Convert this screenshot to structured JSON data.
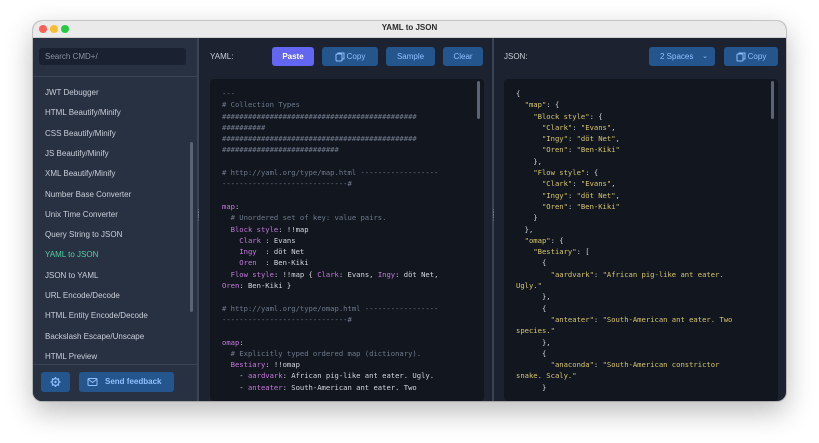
{
  "window": {
    "title": "YAML to JSON"
  },
  "sidebar": {
    "search_placeholder": "Search CMD+/",
    "items": [
      {
        "label": "JWT Debugger",
        "active": false
      },
      {
        "label": "HTML Beautify/Minify",
        "active": false
      },
      {
        "label": "CSS Beautify/Minify",
        "active": false
      },
      {
        "label": "JS Beautify/Minify",
        "active": false
      },
      {
        "label": "XML Beautify/Minify",
        "active": false
      },
      {
        "label": "Number Base Converter",
        "active": false
      },
      {
        "label": "Unix Time Converter",
        "active": false
      },
      {
        "label": "Query String to JSON",
        "active": false
      },
      {
        "label": "YAML to JSON",
        "active": true
      },
      {
        "label": "JSON to YAML",
        "active": false
      },
      {
        "label": "URL Encode/Decode",
        "active": false
      },
      {
        "label": "HTML Entity Encode/Decode",
        "active": false
      },
      {
        "label": "Backslash Escape/Unscape",
        "active": false
      },
      {
        "label": "HTML Preview",
        "active": false
      }
    ],
    "settings_icon": "gear-icon",
    "feedback_label": "Send feedback",
    "feedback_icon": "mail-icon"
  },
  "yaml_panel": {
    "label": "YAML:",
    "paste_label": "Paste",
    "copy_label": "Copy",
    "sample_label": "Sample",
    "clear_label": "Clear",
    "lines": [
      [
        {
          "t": "---",
          "c": "cm"
        }
      ],
      [
        {
          "t": "# Collection Types",
          "c": "cm"
        }
      ],
      [
        {
          "t": "#############################################",
          "c": "cm"
        }
      ],
      [
        {
          "t": "##########",
          "c": "cm"
        }
      ],
      [
        {
          "t": "#############################################",
          "c": "cm"
        }
      ],
      [
        {
          "t": "###########################",
          "c": "cm"
        }
      ],
      [],
      [
        {
          "t": "# http://yaml.org/type/map.html ------------------",
          "c": "cm"
        }
      ],
      [
        {
          "t": "-----------------------------#",
          "c": "cm"
        }
      ],
      [],
      [
        {
          "t": "map",
          "c": "ky"
        },
        {
          "t": ":",
          "c": "vl"
        }
      ],
      [
        {
          "t": "  # Unordered set of key: value pairs.",
          "c": "cm"
        }
      ],
      [
        {
          "t": "  Block style",
          "c": "ky"
        },
        {
          "t": ": !!map",
          "c": "vl"
        }
      ],
      [
        {
          "t": "    Clark ",
          "c": "ky"
        },
        {
          "t": ": Evans",
          "c": "vl"
        }
      ],
      [
        {
          "t": "    Ingy  ",
          "c": "ky"
        },
        {
          "t": ": döt Net",
          "c": "vl"
        }
      ],
      [
        {
          "t": "    Oren  ",
          "c": "ky"
        },
        {
          "t": ": Ben-Kiki",
          "c": "vl"
        }
      ],
      [
        {
          "t": "  Flow style",
          "c": "ky"
        },
        {
          "t": ": !!map { ",
          "c": "vl"
        },
        {
          "t": "Clark",
          "c": "ky"
        },
        {
          "t": ": Evans, ",
          "c": "vl"
        },
        {
          "t": "Ingy",
          "c": "ky"
        },
        {
          "t": ": döt Net,",
          "c": "vl"
        }
      ],
      [
        {
          "t": "Oren",
          "c": "ky"
        },
        {
          "t": ": Ben-Kiki }",
          "c": "vl"
        }
      ],
      [],
      [
        {
          "t": "# http://yaml.org/type/omap.html -----------------",
          "c": "cm"
        }
      ],
      [
        {
          "t": "-----------------------------#",
          "c": "cm"
        }
      ],
      [],
      [
        {
          "t": "omap",
          "c": "ky"
        },
        {
          "t": ":",
          "c": "vl"
        }
      ],
      [
        {
          "t": "  # Explicitly typed ordered map (dictionary).",
          "c": "cm"
        }
      ],
      [
        {
          "t": "  Bestiary",
          "c": "ky"
        },
        {
          "t": ": !!omap",
          "c": "vl"
        }
      ],
      [
        {
          "t": "    - ",
          "c": "vl"
        },
        {
          "t": "aardvark",
          "c": "ky"
        },
        {
          "t": ": African pig-like ant eater. Ugly.",
          "c": "vl"
        }
      ],
      [
        {
          "t": "    - ",
          "c": "vl"
        },
        {
          "t": "anteater",
          "c": "ky"
        },
        {
          "t": ": South-American ant eater. Two",
          "c": "vl"
        }
      ]
    ]
  },
  "json_panel": {
    "label": "JSON:",
    "indent_select": "2 Spaces",
    "copy_label": "Copy",
    "lines": [
      [
        {
          "t": "{",
          "c": "vl"
        }
      ],
      [
        {
          "t": "  ",
          "c": "vl"
        },
        {
          "t": "\"map\"",
          "c": "js-k"
        },
        {
          "t": ": {",
          "c": "vl"
        }
      ],
      [
        {
          "t": "    ",
          "c": "vl"
        },
        {
          "t": "\"Block style\"",
          "c": "js-k"
        },
        {
          "t": ": {",
          "c": "vl"
        }
      ],
      [
        {
          "t": "      ",
          "c": "vl"
        },
        {
          "t": "\"Clark\"",
          "c": "js-k"
        },
        {
          "t": ": ",
          "c": "vl"
        },
        {
          "t": "\"Evans\"",
          "c": "js-s"
        },
        {
          "t": ",",
          "c": "vl"
        }
      ],
      [
        {
          "t": "      ",
          "c": "vl"
        },
        {
          "t": "\"Ingy\"",
          "c": "js-k"
        },
        {
          "t": ": ",
          "c": "vl"
        },
        {
          "t": "\"döt Net\"",
          "c": "js-s"
        },
        {
          "t": ",",
          "c": "vl"
        }
      ],
      [
        {
          "t": "      ",
          "c": "vl"
        },
        {
          "t": "\"Oren\"",
          "c": "js-k"
        },
        {
          "t": ": ",
          "c": "vl"
        },
        {
          "t": "\"Ben-Kiki\"",
          "c": "js-s"
        }
      ],
      [
        {
          "t": "    },",
          "c": "vl"
        }
      ],
      [
        {
          "t": "    ",
          "c": "vl"
        },
        {
          "t": "\"Flow style\"",
          "c": "js-k"
        },
        {
          "t": ": {",
          "c": "vl"
        }
      ],
      [
        {
          "t": "      ",
          "c": "vl"
        },
        {
          "t": "\"Clark\"",
          "c": "js-k"
        },
        {
          "t": ": ",
          "c": "vl"
        },
        {
          "t": "\"Evans\"",
          "c": "js-s"
        },
        {
          "t": ",",
          "c": "vl"
        }
      ],
      [
        {
          "t": "      ",
          "c": "vl"
        },
        {
          "t": "\"Ingy\"",
          "c": "js-k"
        },
        {
          "t": ": ",
          "c": "vl"
        },
        {
          "t": "\"döt Net\"",
          "c": "js-s"
        },
        {
          "t": ",",
          "c": "vl"
        }
      ],
      [
        {
          "t": "      ",
          "c": "vl"
        },
        {
          "t": "\"Oren\"",
          "c": "js-k"
        },
        {
          "t": ": ",
          "c": "vl"
        },
        {
          "t": "\"Ben-Kiki\"",
          "c": "js-s"
        }
      ],
      [
        {
          "t": "    }",
          "c": "vl"
        }
      ],
      [
        {
          "t": "  },",
          "c": "vl"
        }
      ],
      [
        {
          "t": "  ",
          "c": "vl"
        },
        {
          "t": "\"omap\"",
          "c": "js-k"
        },
        {
          "t": ": {",
          "c": "vl"
        }
      ],
      [
        {
          "t": "    ",
          "c": "vl"
        },
        {
          "t": "\"Bestiary\"",
          "c": "js-k"
        },
        {
          "t": ": [",
          "c": "vl"
        }
      ],
      [
        {
          "t": "      {",
          "c": "vl"
        }
      ],
      [
        {
          "t": "        ",
          "c": "vl"
        },
        {
          "t": "\"aardvark\"",
          "c": "js-k"
        },
        {
          "t": ": ",
          "c": "vl"
        },
        {
          "t": "\"African pig-like ant eater.",
          "c": "js-s"
        }
      ],
      [
        {
          "t": "Ugly.\"",
          "c": "js-s"
        }
      ],
      [
        {
          "t": "      },",
          "c": "vl"
        }
      ],
      [
        {
          "t": "      {",
          "c": "vl"
        }
      ],
      [
        {
          "t": "        ",
          "c": "vl"
        },
        {
          "t": "\"anteater\"",
          "c": "js-k"
        },
        {
          "t": ": ",
          "c": "vl"
        },
        {
          "t": "\"South-American ant eater. Two",
          "c": "js-s"
        }
      ],
      [
        {
          "t": "species.\"",
          "c": "js-s"
        }
      ],
      [
        {
          "t": "      },",
          "c": "vl"
        }
      ],
      [
        {
          "t": "      {",
          "c": "vl"
        }
      ],
      [
        {
          "t": "        ",
          "c": "vl"
        },
        {
          "t": "\"anaconda\"",
          "c": "js-k"
        },
        {
          "t": ": ",
          "c": "vl"
        },
        {
          "t": "\"South-American constrictor",
          "c": "js-s"
        }
      ],
      [
        {
          "t": "snake. Scaly.\"",
          "c": "js-s"
        }
      ],
      [
        {
          "t": "      }",
          "c": "vl"
        }
      ]
    ]
  },
  "colors": {
    "accent": "#6366f1",
    "active_item": "#4fd0a5",
    "button_bg": "#24558c",
    "button_text": "#8fc0ff"
  }
}
